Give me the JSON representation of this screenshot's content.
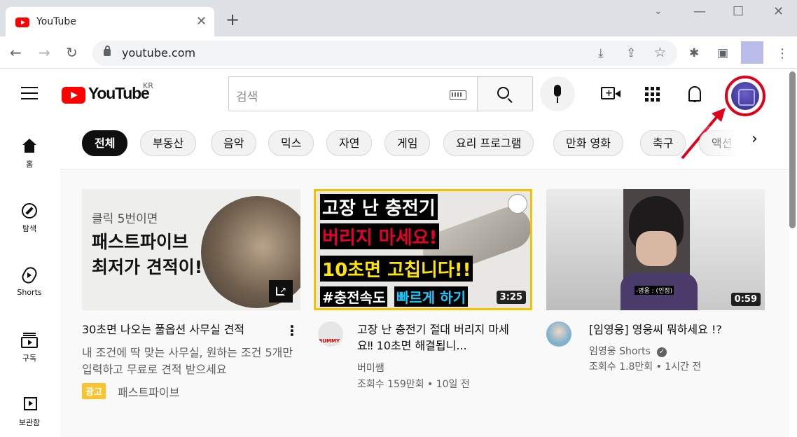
{
  "browser": {
    "tab_title": "YouTube",
    "tab_close": "✕",
    "new_tab": "+",
    "url": "youtube.com",
    "back": "←",
    "forward": "→",
    "reload": "↻",
    "install_icon": "⤓",
    "share_icon": "⇪",
    "star_icon": "☆",
    "extensions_icon": "✱",
    "sidepanel_icon": "▣",
    "menu_icon": "⋮",
    "minimize": "—",
    "maximize": "☐",
    "close": "✕"
  },
  "header": {
    "logo_text": "YouTube",
    "region": "KR",
    "search_placeholder": "검색"
  },
  "sidebar": {
    "items": [
      {
        "label": "홈",
        "icon": "home-icon"
      },
      {
        "label": "탐색",
        "icon": "compass-icon"
      },
      {
        "label": "Shorts",
        "icon": "shorts-icon"
      },
      {
        "label": "구독",
        "icon": "subscriptions-icon"
      },
      {
        "label": "보관함",
        "icon": "library-icon"
      }
    ]
  },
  "chips": [
    "전체",
    "부동산",
    "음악",
    "믹스",
    "자연",
    "게임",
    "요리 프로그램",
    "만화 영화",
    "축구",
    "액션"
  ],
  "chip_next": "›",
  "videos": [
    {
      "title": "30초면 나오는 풀옵션 사무실 견적",
      "description": "내 조건에 딱 맞는 사무실, 원하는 조건 5개만 입력하고 무료로 견적 받으세요",
      "ad_badge": "광고",
      "channel": "패스트파이브",
      "thumb_line1": "클릭 5번이면",
      "thumb_line2": "패스트파이브",
      "thumb_line3": "최저가 견적이!",
      "more_icon": "⋮"
    },
    {
      "title": "고장 난 충전기 절대 버리지 마세요‼ 10초면 해결됩니...",
      "channel": "버미쌤",
      "stats": "조회수 159만회 • 10일 전",
      "duration": "3:25",
      "thumb_line1": "고장 난 충전기",
      "thumb_line2": "버리지 마세요!",
      "thumb_line3": "10초면 고칩니다!!",
      "thumb_line4_a": "#충전속도",
      "thumb_line4_b": "빠르게 하기",
      "avatar_text": "BUMMY"
    },
    {
      "title": "[임영웅] 영웅씨 뭐하세요 !?",
      "channel": "임영웅 Shorts",
      "verified": "✓",
      "stats": "조회수 1.8만회 • 1시간 전",
      "duration": "0:59",
      "caption": "-영웅 : (인정)"
    }
  ],
  "colors": {
    "accent": "#ff0000",
    "highlight_ring": "#e0001b",
    "ad_badge": "#f9c42e"
  }
}
